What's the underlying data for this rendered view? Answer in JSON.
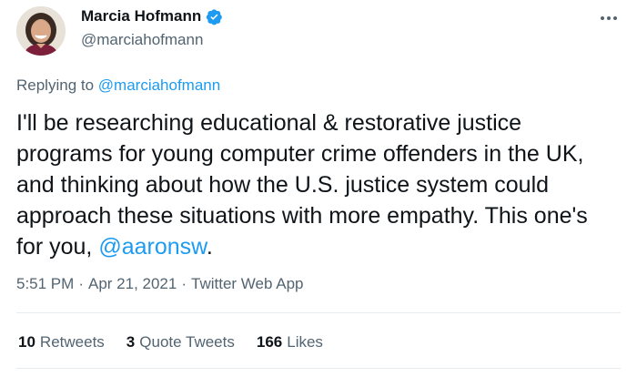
{
  "author": {
    "name": "Marcia Hofmann",
    "handle": "@marciahofmann",
    "verified_color": "#1d9bf0"
  },
  "reply": {
    "prefix": "Replying to ",
    "handle": "@marciahofmann"
  },
  "tweet": {
    "text_before": "I'll be researching educational & restorative justice programs for young computer crime offenders in the UK, and thinking about how the U.S. justice system could approach these situations with more empathy. This one's for you, ",
    "mention": "@aaronsw",
    "text_after": "."
  },
  "meta": {
    "time": "5:51 PM",
    "separator": "·",
    "date": "Apr 21, 2021",
    "source": "Twitter Web App"
  },
  "stats": {
    "retweets_count": "10",
    "retweets_label": "Retweets",
    "quotes_count": "3",
    "quotes_label": "Quote Tweets",
    "likes_count": "166",
    "likes_label": "Likes"
  },
  "colors": {
    "accent": "#1d9bf0",
    "secondary_text": "#536471",
    "primary_text": "#0f1419"
  },
  "icons": {
    "verified": "verified-badge-icon",
    "more": "more-options-icon"
  }
}
